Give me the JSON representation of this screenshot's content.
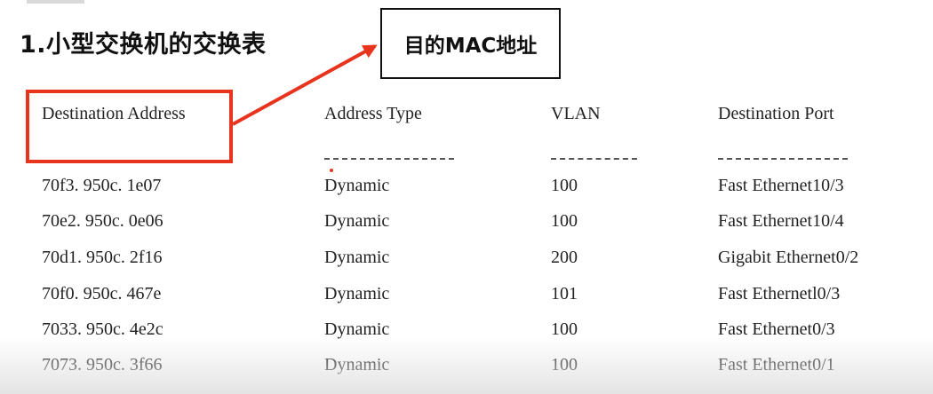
{
  "slide": {
    "title": "1.小型交换机的交换表",
    "callout": "目的MAC地址"
  },
  "colors": {
    "highlight": "#e8331d",
    "text": "#222222"
  },
  "table": {
    "headers": [
      "Destination Address",
      "Address Type",
      "VLAN",
      "Destination Port"
    ],
    "rows": [
      [
        "70f3. 950c. 1e07",
        "Dynamic",
        "100",
        "Fast Ethernet10/3"
      ],
      [
        "70e2. 950c. 0e06",
        "Dynamic",
        "100",
        "Fast Ethernet10/4"
      ],
      [
        "70d1. 950c. 2f16",
        "Dynamic",
        "200",
        "Gigabit Ethernet0/2"
      ],
      [
        "70f0. 950c. 467e",
        "Dynamic",
        "101",
        "Fast Ethernetl0/3"
      ],
      [
        "7033. 950c. 4e2c",
        "Dynamic",
        "100",
        "Fast Ethernet0/3"
      ],
      [
        "7073. 950c. 3f66",
        "Dynamic",
        "100",
        "Fast Ethernet0/1"
      ]
    ]
  }
}
